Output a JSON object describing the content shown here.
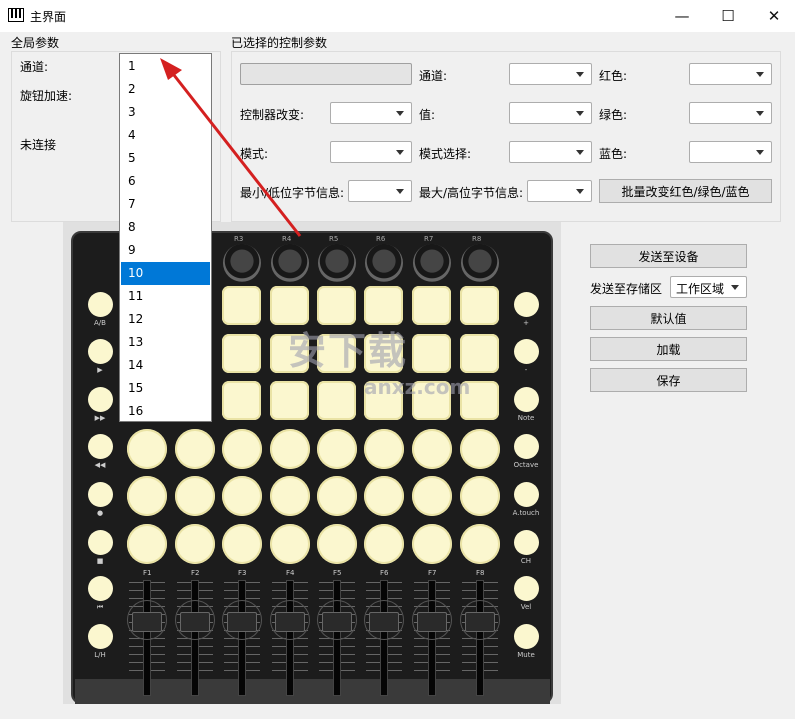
{
  "window": {
    "title": "主界面",
    "minimize": "—",
    "maximize": "☐",
    "close": "✕"
  },
  "global_params": {
    "title": "全局参数",
    "channel_label": "通道:",
    "knob_accel_label": "旋钮加速:",
    "connection_status": "未连接"
  },
  "dropdown": {
    "options": [
      "1",
      "2",
      "3",
      "4",
      "5",
      "6",
      "7",
      "8",
      "9",
      "10",
      "11",
      "12",
      "13",
      "14",
      "15",
      "16"
    ],
    "selected": "10"
  },
  "selected_params": {
    "title": "已选择的控制参数",
    "channel_label": "通道:",
    "red_label": "红色:",
    "controller_change_label": "控制器改变:",
    "value_label": "值:",
    "green_label": "绿色:",
    "mode_label": "模式:",
    "mode_select_label": "模式选择:",
    "blue_label": "蓝色:",
    "min_byte_label": "最小/低位字节信息:",
    "max_byte_label": "最大/高位字节信息:",
    "batch_button": "批量改变红色/绿色/蓝色"
  },
  "actions": {
    "send_device": "发送至设备",
    "send_storage_label": "发送至存储区",
    "storage_value": "工作区域",
    "default": "默认值",
    "load": "加载",
    "save": "保存"
  },
  "device": {
    "knob_labels": [
      "R3",
      "R4",
      "R5",
      "R6",
      "R7",
      "R8"
    ],
    "left_labels": [
      "A/B",
      "▶",
      "▶▶",
      "◀◀",
      "●",
      "■",
      "⏮",
      "L/H"
    ],
    "right_labels": [
      "+",
      "-",
      "Note",
      "Octave",
      "A.touch",
      "CH",
      "Vel",
      "Mute"
    ],
    "fader_labels": [
      "F1",
      "F2",
      "F3",
      "F4",
      "F5",
      "F6",
      "F7",
      "F8"
    ]
  },
  "watermark": {
    "text": "安下载",
    "url": "anxz.com"
  },
  "colors": {
    "selection": "#0078d7",
    "pad": "#fbf7cf",
    "arrow": "#d42020"
  }
}
